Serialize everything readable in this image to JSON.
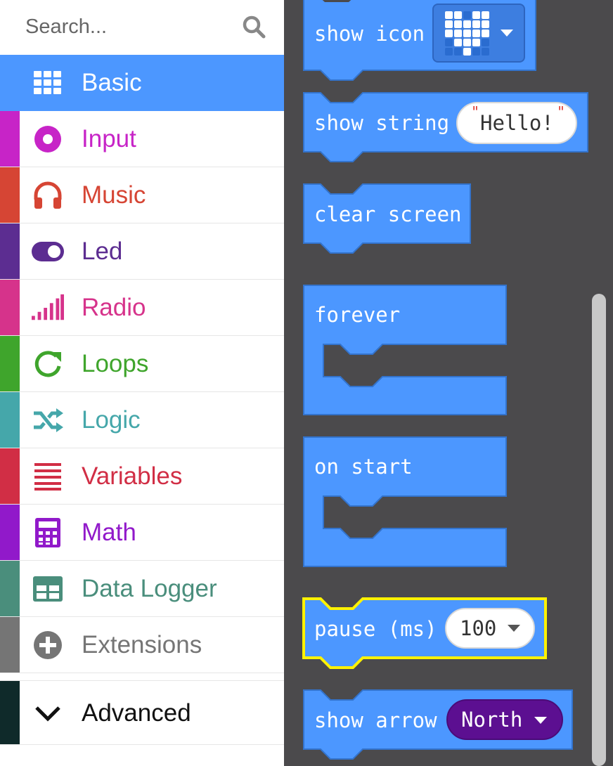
{
  "search": {
    "placeholder": "Search..."
  },
  "toolbox": {
    "categories": [
      {
        "label": "Basic",
        "color": "#4c97ff",
        "icon": "grid-icon",
        "selected": true
      },
      {
        "label": "Input",
        "color": "#d400d4",
        "icon": "target-icon"
      },
      {
        "label": "Music",
        "color": "#e63022",
        "icon": "headphones-icon"
      },
      {
        "label": "Led",
        "color": "#5c2d91",
        "icon": "toggle-icon"
      },
      {
        "label": "Radio",
        "color": "#e3008c",
        "icon": "signal-bars-icon"
      },
      {
        "label": "Loops",
        "color": "#00aa00",
        "icon": "refresh-icon"
      },
      {
        "label": "Logic",
        "color": "#00a4a6",
        "icon": "shuffle-icon"
      },
      {
        "label": "Variables",
        "color": "#dc143c",
        "icon": "list-lines-icon"
      },
      {
        "label": "Math",
        "color": "#9400d3",
        "icon": "calculator-icon"
      },
      {
        "label": "Data Logger",
        "color": "#378273",
        "icon": "table-icon"
      },
      {
        "label": "Extensions",
        "color": "#757575",
        "icon": "plus-circle-icon"
      }
    ],
    "advanced": {
      "label": "Advanced",
      "color": "#0a2a2a",
      "icon": "chevron-down-icon"
    }
  },
  "flyout": {
    "show_icon": {
      "label": "show icon",
      "value_icon": "heart-icon"
    },
    "show_string": {
      "label": "show string",
      "value": "Hello!"
    },
    "clear_screen": {
      "label": "clear screen"
    },
    "forever": {
      "label": "forever"
    },
    "on_start": {
      "label": "on start"
    },
    "pause": {
      "label": "pause (ms)",
      "value": "100"
    },
    "show_arrow": {
      "label": "show arrow",
      "value": "North"
    }
  },
  "colors": {
    "block": "#4c97ff",
    "block_border": "#3373cc",
    "flyout_bg": "#4b4a4c",
    "highlight": "#fff200",
    "led_dropdown": "#5c0f91"
  }
}
